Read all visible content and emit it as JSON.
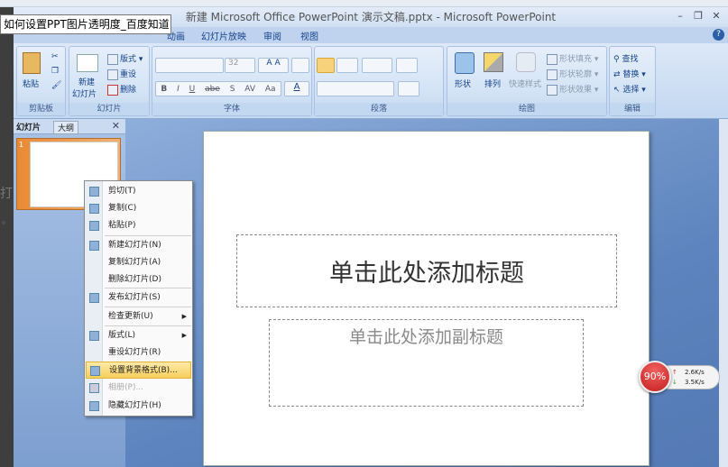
{
  "window": {
    "title": "新建 Microsoft Office PowerPoint 演示文稿.pptx - Microsoft PowerPoint",
    "minimize": "–",
    "restore": "❐",
    "close": "✕",
    "help": "?"
  },
  "tooltip": "如何设置PPT图片透明度_百度知道",
  "left_fragments": [
    "打",
    "。"
  ],
  "tabs": [
    "动画",
    "幻灯片放映",
    "审阅",
    "视图"
  ],
  "ribbon": {
    "clipboard": {
      "paste": "粘贴",
      "label": "剪贴板"
    },
    "slides": {
      "new_slide": "新建\n幻灯片",
      "new": "新建",
      "slide": "幻灯片",
      "layout": "版式",
      "reset": "重设",
      "delete": "删除",
      "label": "幻灯片"
    },
    "font": {
      "font_name": "",
      "font_size": "32",
      "bold": "B",
      "italic": "I",
      "underline": "U",
      "strike": "abe",
      "shadow": "S",
      "spacing": "AV",
      "case": "Aa",
      "grow": "A",
      "shrink": "A",
      "color": "A",
      "label": "字体"
    },
    "paragraph": {
      "label": "段落"
    },
    "drawing": {
      "shapes": "形状",
      "arrange": "排列",
      "quick_styles": "快速样式",
      "fill": "形状填充",
      "outline": "形状轮廓",
      "effects": "形状效果",
      "label": "绘图"
    },
    "editing": {
      "find": "查找",
      "replace": "替换",
      "select": "选择",
      "label": "编辑"
    }
  },
  "panel": {
    "tabs": [
      "幻灯片",
      "大纲"
    ],
    "close": "✕",
    "slide_number": "1"
  },
  "slide": {
    "title_placeholder": "单击此处添加标题",
    "subtitle_placeholder": "单击此处添加副标题"
  },
  "context_menu": [
    {
      "label": "剪切(T)",
      "icon": "scissors-icon"
    },
    {
      "label": "复制(C)",
      "icon": "copy-icon"
    },
    {
      "label": "粘贴(P)",
      "icon": "paste-icon"
    },
    {
      "label": "新建幻灯片(N)",
      "icon": "new-slide-icon"
    },
    {
      "label": "复制幻灯片(A)"
    },
    {
      "label": "删除幻灯片(D)"
    },
    {
      "label": "发布幻灯片(S)",
      "icon": "publish-icon"
    },
    {
      "label": "检查更新(U)",
      "submenu": true
    },
    {
      "label": "版式(L)",
      "icon": "layout-icon",
      "submenu": true
    },
    {
      "label": "重设幻灯片(R)"
    },
    {
      "label": "设置背景格式(B)...",
      "icon": "background-icon",
      "highlighted": true
    },
    {
      "label": "相册(P)...",
      "icon": "photo-album-icon",
      "disabled": true
    },
    {
      "label": "隐藏幻灯片(H)",
      "icon": "hide-slide-icon"
    }
  ],
  "speed_widget": {
    "percent": "90%",
    "upload": "2.6K/s",
    "download": "3.5K/s",
    "color": "#d42a2a"
  }
}
